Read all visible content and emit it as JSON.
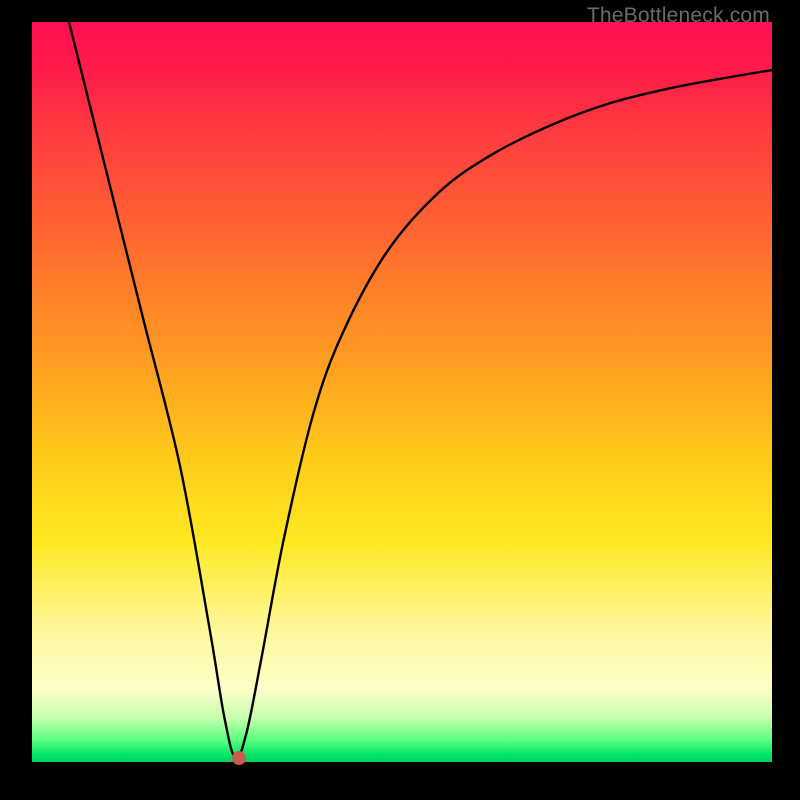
{
  "watermark": "TheBottleneck.com",
  "chart_data": {
    "type": "line",
    "title": "",
    "xlabel": "",
    "ylabel": "",
    "xlim": [
      0,
      100
    ],
    "ylim": [
      0,
      100
    ],
    "grid": false,
    "legend": false,
    "background_gradient": {
      "top": "#ff1050",
      "bottom": "#00d060",
      "description": "vertical gradient red→orange→yellow→green"
    },
    "series": [
      {
        "name": "curve",
        "color": "#000000",
        "x": [
          5,
          10,
          15,
          20,
          24,
          26,
          27.5,
          29,
          31,
          34,
          38,
          42,
          48,
          55,
          62,
          70,
          78,
          86,
          94,
          100
        ],
        "y": [
          100,
          80,
          60,
          40,
          18,
          6,
          0.5,
          4,
          14,
          30,
          47,
          58,
          69,
          77,
          82,
          86,
          89,
          91,
          92.5,
          93.5
        ]
      }
    ],
    "marker": {
      "name": "minimum-point",
      "x": 28,
      "y": 0.5,
      "color": "#c95c50"
    }
  }
}
